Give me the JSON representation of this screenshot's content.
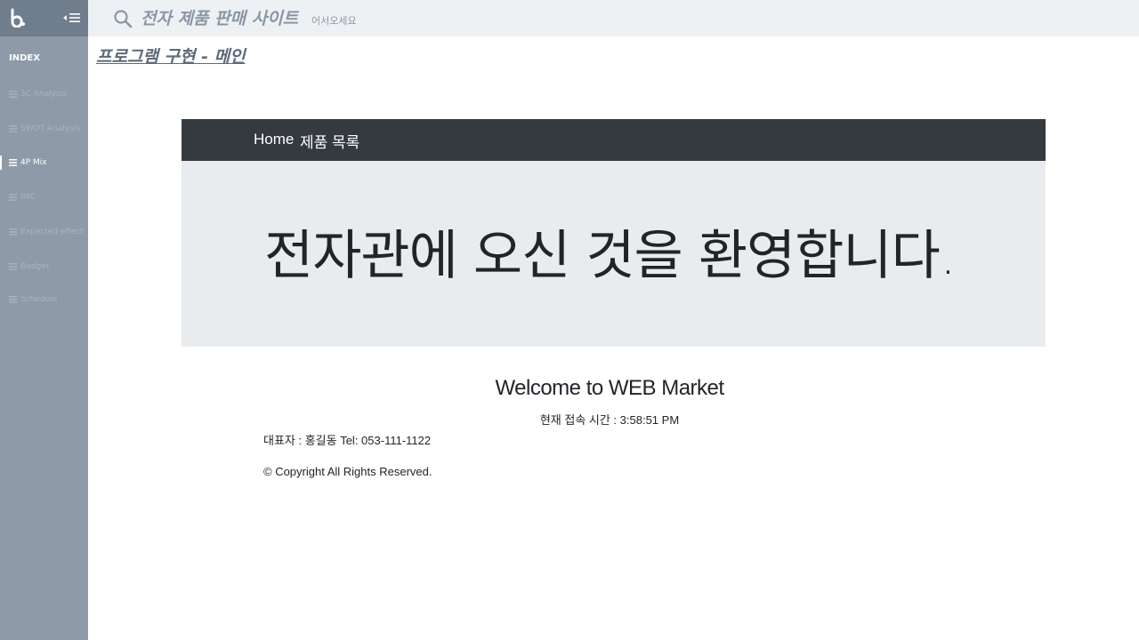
{
  "sidebar": {
    "index_label": "INDEX",
    "items": [
      {
        "label": "3C Analysis",
        "active": false
      },
      {
        "label": "SWOT Analysis",
        "active": false
      },
      {
        "label": "4P Mix",
        "active": true
      },
      {
        "label": "IMC",
        "active": false
      },
      {
        "label": "Expected  effect",
        "active": false
      },
      {
        "label": "Budget",
        "active": false
      },
      {
        "label": "Schedule",
        "active": false
      }
    ],
    "logo_icon": "b-logo-icon",
    "collapse_icon": "collapse-menu-icon",
    "item_icon": "list-icon"
  },
  "topbar": {
    "title": "전자 제품 판매 사이트",
    "subtitle": "어서오세요",
    "search_icon": "search-icon"
  },
  "page": {
    "heading": "프로그램 구현 - 메인"
  },
  "site": {
    "nav": {
      "home": "Home",
      "products": "제품 목록"
    },
    "jumbotron": "전자관에 오신 것을 환영합니다.",
    "welcome": "Welcome to WEB Market",
    "access_time_label": "현재 접속 시간 : ",
    "access_time_value": "3:58:51 PM",
    "footer_owner": "대표자 : 홍길동 Tel: 053-111-1122",
    "footer_copyright": "© Copyright All Rights Reserved."
  },
  "colors": {
    "sidebar_bg": "#8e9aa8",
    "topbar_bg": "#eef1f4",
    "navbar_bg": "#343a40",
    "jumbotron_bg": "#e9ecef"
  }
}
